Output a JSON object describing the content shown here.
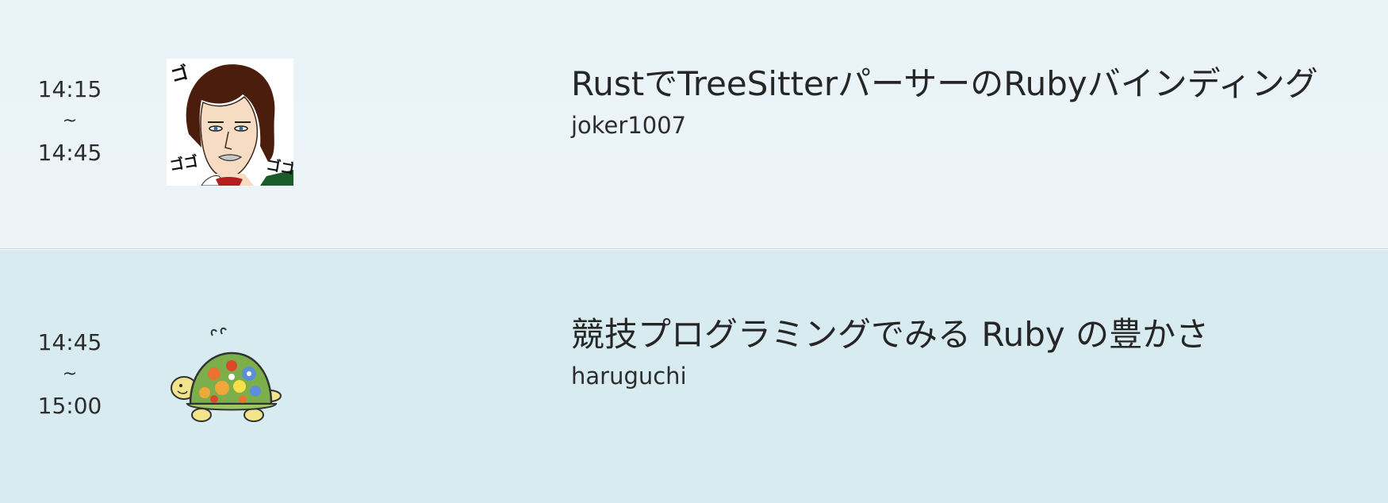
{
  "sessions": [
    {
      "start": "14:15",
      "separator": "~",
      "end": "14:45",
      "title": "RustでTreeSitterパーサーのRubyバインディング",
      "speaker": "joker1007",
      "avatar_icon": "manga-portrait-avatar"
    },
    {
      "start": "14:45",
      "separator": "~",
      "end": "15:00",
      "title": "競技プログラミングでみる Ruby の豊かさ",
      "speaker": "haruguchi",
      "avatar_icon": "turtle-avatar"
    }
  ]
}
